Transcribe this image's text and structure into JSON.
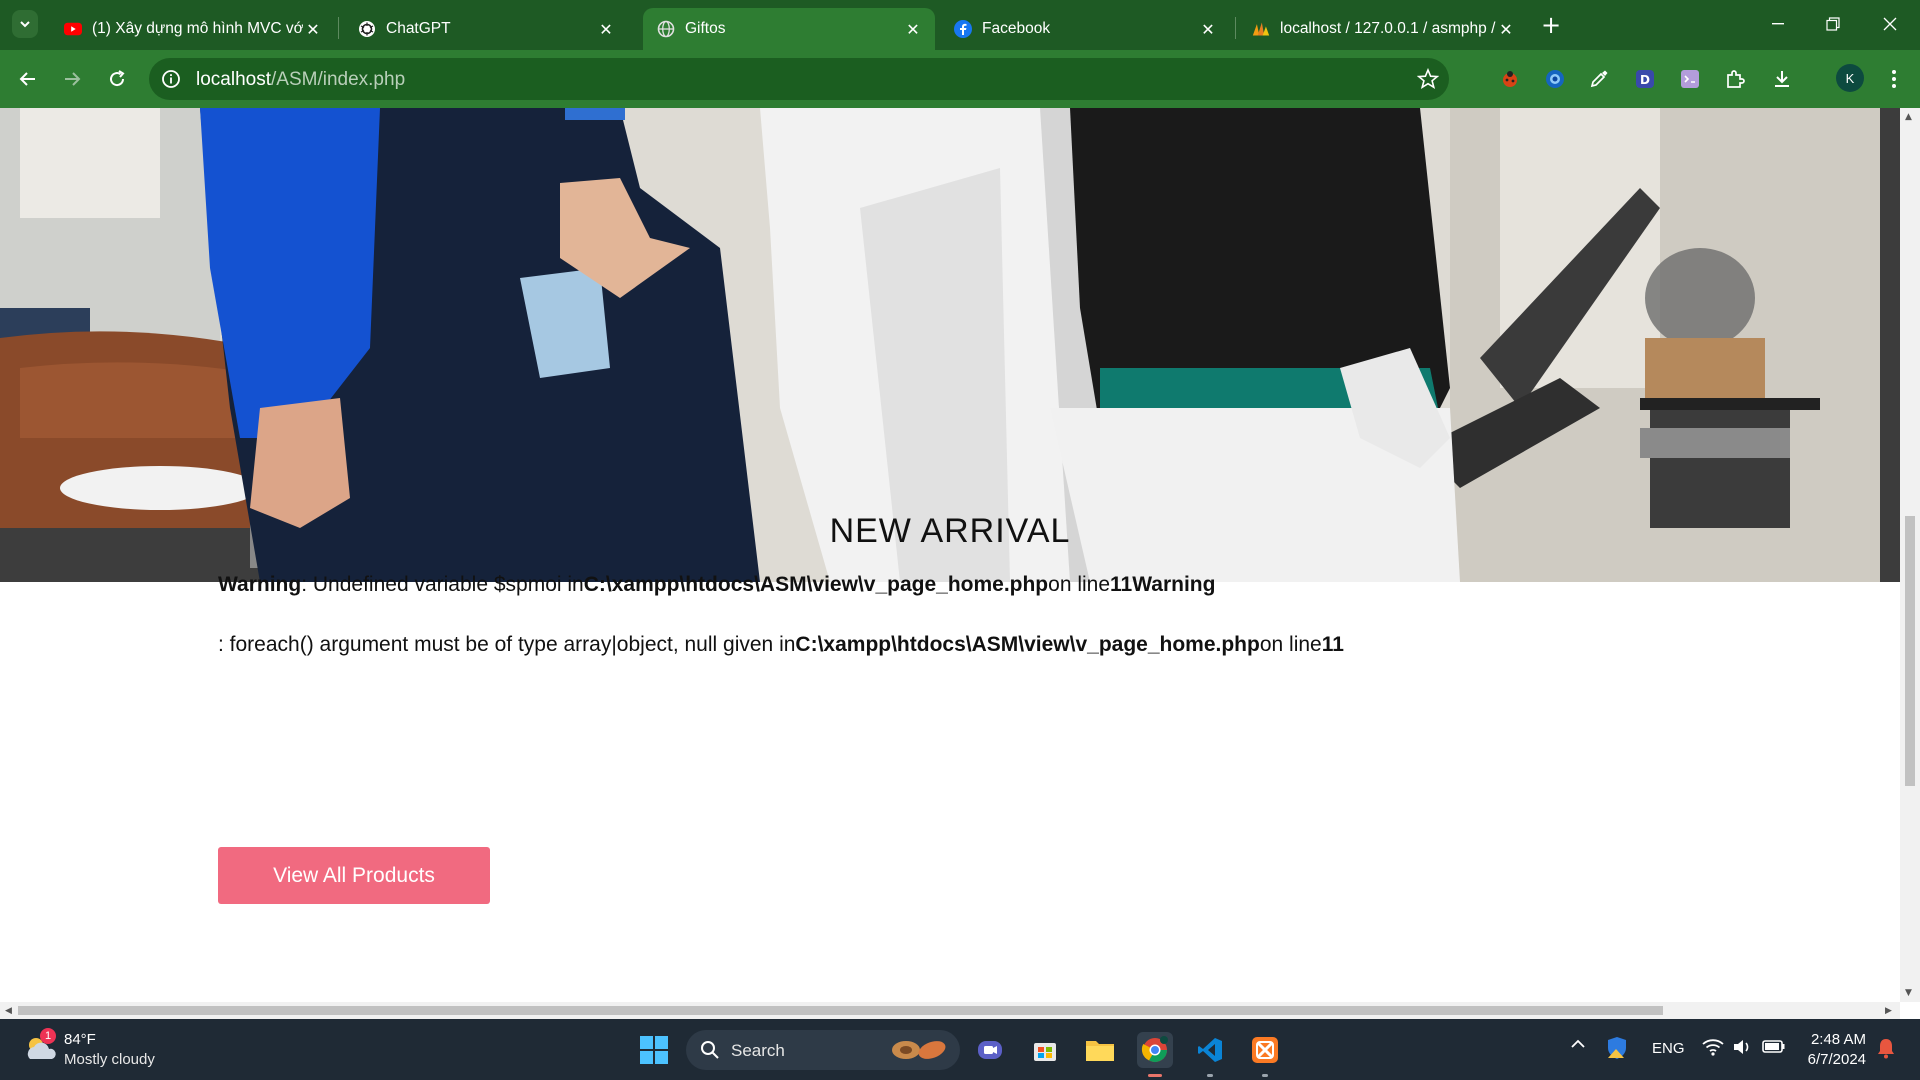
{
  "browser": {
    "tabs": [
      {
        "title": "(1) Xây dựng mô hình MVC với",
        "favicon": "youtube-icon",
        "active": false
      },
      {
        "title": "ChatGPT",
        "favicon": "chatgpt-icon",
        "active": false
      },
      {
        "title": "Giftos",
        "favicon": "globe-icon",
        "active": true
      },
      {
        "title": "Facebook",
        "favicon": "facebook-icon",
        "active": false
      },
      {
        "title": "localhost / 127.0.0.1 / asmphp / ",
        "favicon": "phpmyadmin-icon",
        "active": false
      }
    ],
    "url_host": "localhost",
    "url_path": "/ASM/index.php",
    "profile_initial": "K",
    "colors": {
      "frame": "#1e5a24",
      "toolbar": "#2e7d32",
      "omnibox": "#1b5e20"
    }
  },
  "page": {
    "section_title": "NEW ARRIVAL",
    "warning1": {
      "label": "Warning",
      "message": ": Undefined variable $spmoi in",
      "file": "C:\\xampp\\htdocs\\ASM\\view\\v_page_home.php",
      "line_text": "on line",
      "line": "11",
      "trailing_label": "Warning"
    },
    "warning2": {
      "message": ": foreach() argument must be of type array|object, null given in",
      "file": "C:\\xampp\\htdocs\\ASM\\view\\v_page_home.php",
      "line_text": "on line",
      "line": "11"
    },
    "view_all_label": "View All Products",
    "button_color": "#f16a80"
  },
  "taskbar": {
    "weather_badge": "1",
    "weather_temp": "84°F",
    "weather_desc": "Mostly cloudy",
    "search_label": "Search",
    "language": "ENG",
    "time": "2:48 AM",
    "date": "6/7/2024"
  }
}
